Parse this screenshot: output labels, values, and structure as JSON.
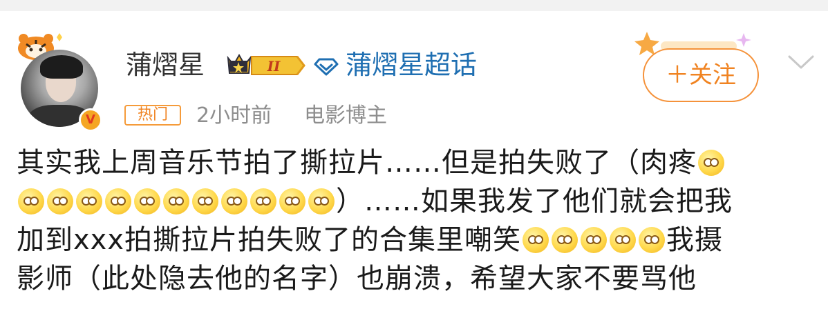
{
  "user": {
    "name": "蒲熠星",
    "level_badge": "II",
    "topic": "蒲熠星超话",
    "verified_mark": "V"
  },
  "meta": {
    "tag": "热门",
    "time": "2小时前",
    "role": "电影博主"
  },
  "actions": {
    "follow_label": "＋关注"
  },
  "post": {
    "line1_text": "其实我上周音乐节拍了撕拉片……但是拍失败了（肉疼",
    "line2_text": "）……如果我发了他们就会把我",
    "line3_text_a": "加到xxx拍撕拉片拍失败了的合集里嘲笑",
    "line3_text_b": "我摄",
    "line4_text": "影师（此处隐去他的名字）也崩溃，希望大家不要骂他",
    "emoji_name": "allow-emoji"
  },
  "colors": {
    "accent_orange": "#f08321",
    "topic_blue": "#1f6fb2",
    "meta_gray": "#8d8d8d"
  }
}
